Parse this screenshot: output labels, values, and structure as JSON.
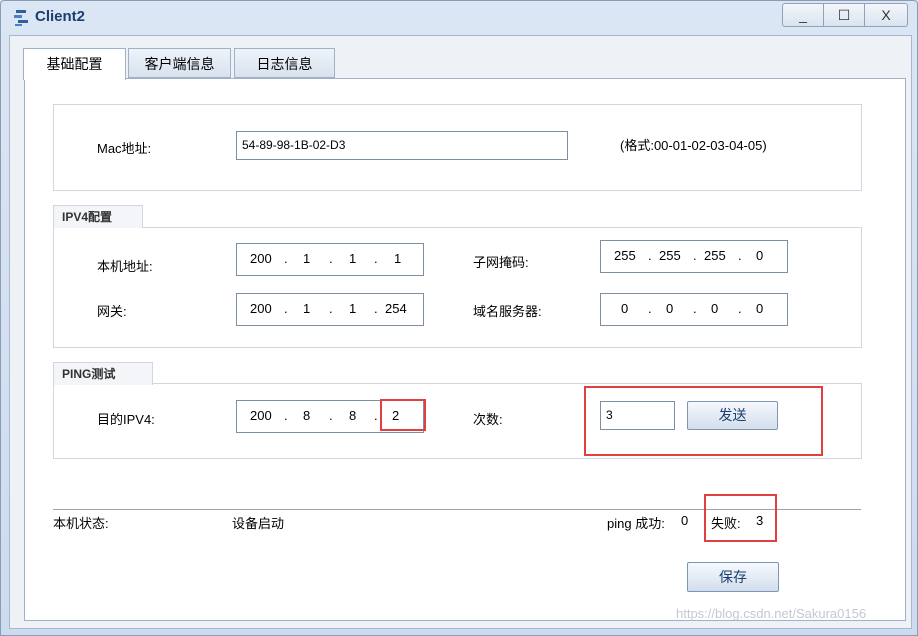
{
  "window": {
    "title": "Client2",
    "minimize": "_",
    "maximize": "☐",
    "close": "X"
  },
  "tabs": [
    "基础配置",
    "客户端信息",
    "日志信息"
  ],
  "mac": {
    "label": "Mac地址:",
    "value": "54-89-98-1B-02-D3",
    "format_hint": "(格式:00-01-02-03-04-05)"
  },
  "ipv4": {
    "section": "IPV4配置",
    "local_label": "本机地址:",
    "local": [
      "200",
      "1",
      "1",
      "1"
    ],
    "mask_label": "子网掩码:",
    "mask": [
      "255",
      "255",
      "255",
      "0"
    ],
    "gateway_label": "网关:",
    "gateway": [
      "200",
      "1",
      "1",
      "254"
    ],
    "dns_label": "域名服务器:",
    "dns": [
      "0",
      "0",
      "0",
      "0"
    ]
  },
  "ping": {
    "section": "PING测试",
    "dest_label": "目的IPV4:",
    "dest": [
      "200",
      "8",
      "8",
      "2"
    ],
    "count_label": "次数:",
    "count": "3",
    "send": "发送"
  },
  "status": {
    "label": "本机状态:",
    "value": "设备启动",
    "success_label": "ping 成功:",
    "success": "0",
    "fail_label": "失败:",
    "fail": "3"
  },
  "save": "保存",
  "watermark": "https://blog.csdn.net/Sakura0156"
}
